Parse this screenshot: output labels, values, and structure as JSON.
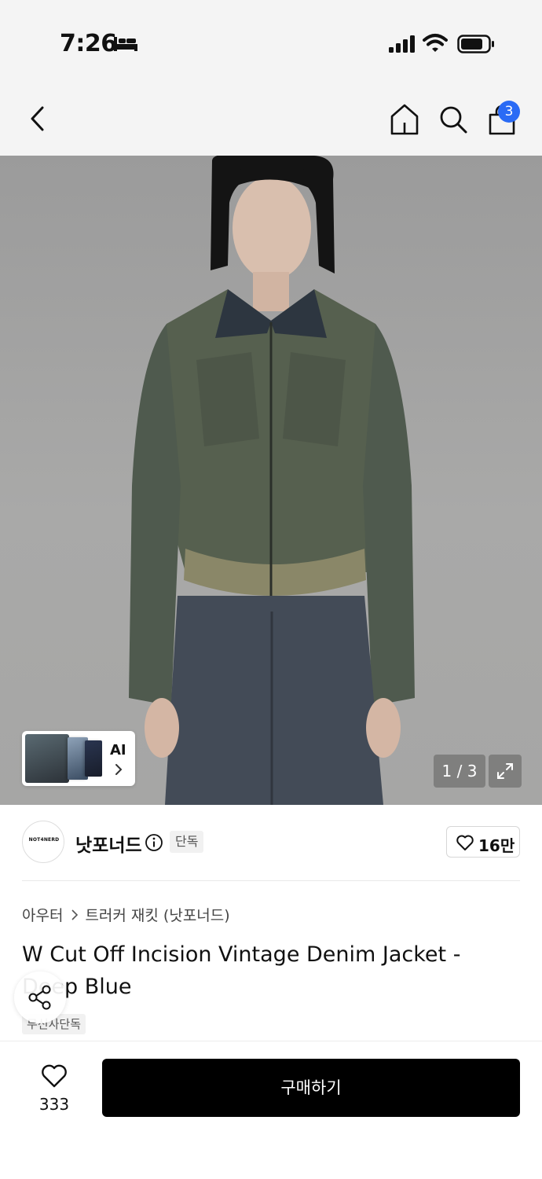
{
  "status_bar": {
    "time": "7:26",
    "icons": [
      "sleep-icon",
      "signal-icon",
      "wifi-icon",
      "battery-icon"
    ]
  },
  "nav": {
    "icons": [
      "back-icon",
      "home-icon",
      "search-icon",
      "cart-icon"
    ],
    "cart_badge": "3",
    "badge_color": "#2a6bf5"
  },
  "gallery": {
    "ai_label": "AI",
    "counter": "1 / 3",
    "current_image": 1,
    "total_images": 3
  },
  "brand": {
    "logo_text": "NOT4NERD",
    "name": "낫포너드",
    "exclusive_badge": "단독",
    "like_count": "16만"
  },
  "product": {
    "breadcrumb": [
      "아우터",
      "트러커 재킷 (낫포너드)"
    ],
    "title": "W Cut Off Incision Vintage Denim Jacket - Deep Blue",
    "store_badge": "무신사단독"
  },
  "bottom_bar": {
    "wish_count": "333",
    "buy_label": "구매하기",
    "buy_button_color": "#000000"
  }
}
